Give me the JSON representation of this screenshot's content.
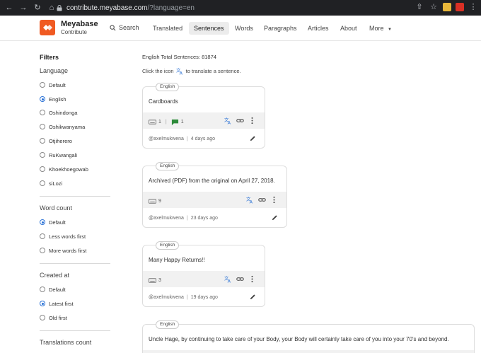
{
  "browser": {
    "url_host": "contribute.meyabase.com",
    "url_path": "/?language=en"
  },
  "header": {
    "brand_title": "Meyabase",
    "brand_subtitle": "Contribute",
    "search_label": "Search",
    "nav": [
      {
        "label": "Translated",
        "active": false
      },
      {
        "label": "Sentences",
        "active": true
      },
      {
        "label": "Words",
        "active": false
      },
      {
        "label": "Paragraphs",
        "active": false
      },
      {
        "label": "Articles",
        "active": false
      },
      {
        "label": "About",
        "active": false
      },
      {
        "label": "More",
        "active": false
      }
    ],
    "accent": "#f05a22"
  },
  "sidebar": {
    "title": "Filters",
    "language": {
      "title": "Language",
      "options": [
        {
          "label": "Default",
          "selected": false
        },
        {
          "label": "English",
          "selected": true
        },
        {
          "label": "Oshindonga",
          "selected": false
        },
        {
          "label": "Oshikwanyama",
          "selected": false
        },
        {
          "label": "Otjiherero",
          "selected": false
        },
        {
          "label": "RuKwangali",
          "selected": false
        },
        {
          "label": "Khoekhoegowab",
          "selected": false
        },
        {
          "label": "siLozi",
          "selected": false
        }
      ]
    },
    "word_count": {
      "title": "Word count",
      "options": [
        {
          "label": "Default",
          "selected": true
        },
        {
          "label": "Less words first",
          "selected": false
        },
        {
          "label": "More words first",
          "selected": false
        }
      ]
    },
    "created_at": {
      "title": "Created at",
      "options": [
        {
          "label": "Default",
          "selected": false
        },
        {
          "label": "Latest first",
          "selected": true
        },
        {
          "label": "Old first",
          "selected": false
        }
      ]
    },
    "translations_count": {
      "title": "Translations count"
    }
  },
  "main": {
    "total_label": "English Total Sentences: 81874",
    "hint_before": "Click the icon",
    "hint_after": "to translate a sentence.",
    "cards": [
      {
        "language": "English",
        "text": "Cardboards",
        "words": "1",
        "comments": "1",
        "author": "@axelmukwena",
        "age": "4 days ago"
      },
      {
        "language": "English",
        "text": "Archived (PDF) from the original on April 27, 2018.",
        "words": "9",
        "author": "@axelmukwena",
        "age": "23 days ago"
      },
      {
        "language": "English",
        "text": "Many Happy Returns!!",
        "words": "3",
        "author": "@axelmukwena",
        "age": "19 days ago"
      },
      {
        "language": "English",
        "text": "Uncle Hage, by continuing to take care of your Body, your Body will certainly take care of you into your 70's and beyond."
      }
    ],
    "translate_color": "#2b72d6",
    "comment_color": "#2e8b3a"
  }
}
